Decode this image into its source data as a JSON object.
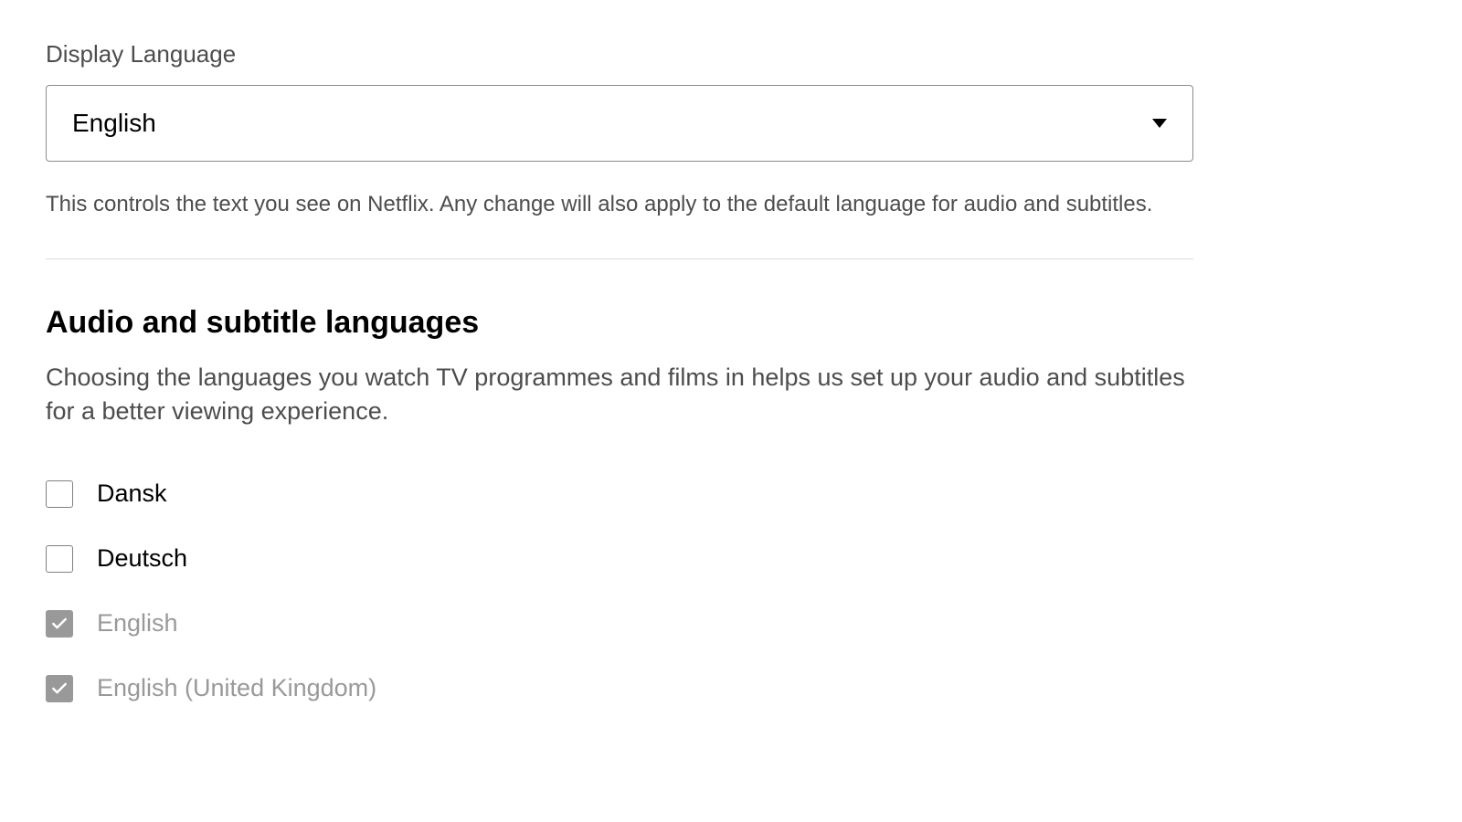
{
  "display_language": {
    "label": "Display Language",
    "value": "English",
    "help": "This controls the text you see on Netflix. Any change will also apply to the default language for audio and subtitles."
  },
  "audio_subtitle": {
    "heading": "Audio and subtitle languages",
    "description": "Choosing the languages you watch TV programmes and films in helps us set up your audio and subtitles for a better viewing experience.",
    "options": [
      {
        "label": "Dansk",
        "checked": false,
        "disabled": false
      },
      {
        "label": "Deutsch",
        "checked": false,
        "disabled": false
      },
      {
        "label": "English",
        "checked": true,
        "disabled": true
      },
      {
        "label": "English (United Kingdom)",
        "checked": true,
        "disabled": true
      }
    ]
  }
}
